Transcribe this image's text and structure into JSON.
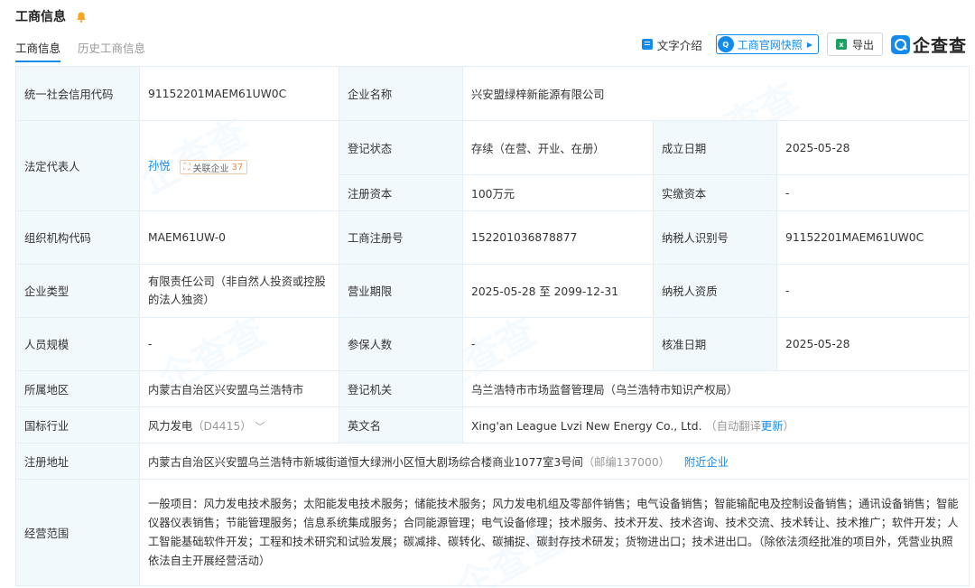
{
  "header": {
    "title": "工商信息"
  },
  "tabs": [
    {
      "label": "工商信息",
      "active": true
    },
    {
      "label": "历史工商信息",
      "active": false
    }
  ],
  "toolbar": {
    "text_intro": "文字介绍",
    "snapshot_badge": "Q",
    "snapshot": "工商官网快照",
    "export": "导出",
    "logo": "企查查"
  },
  "watermark": "企查查",
  "table": {
    "credit_code_label": "统一社会信用代码",
    "credit_code": "91152201MAEM61UW0C",
    "company_name_label": "企业名称",
    "company_name": "兴安盟绿梓新能源有限公司",
    "legal_rep_label": "法定代表人",
    "legal_rep": "孙悦",
    "related_label": "关联企业",
    "related_count": "37",
    "reg_status_label": "登记状态",
    "reg_status": "存续（在营、开业、在册）",
    "established_label": "成立日期",
    "established": "2025-05-28",
    "reg_capital_label": "注册资本",
    "reg_capital": "100万元",
    "paid_capital_label": "实缴资本",
    "paid_capital": "-",
    "org_code_label": "组织机构代码",
    "org_code": "MAEM61UW-0",
    "reg_no_label": "工商注册号",
    "reg_no": "152201036878877",
    "taxpayer_id_label": "纳税人识别号",
    "taxpayer_id": "91152201MAEM61UW0C",
    "company_type_label": "企业类型",
    "company_type": "有限责任公司（非自然人投资或控股的法人独资）",
    "biz_term_label": "营业期限",
    "biz_term": "2025-05-28 至 2099-12-31",
    "taxpayer_qual_label": "纳税人资质",
    "taxpayer_qual": "-",
    "staff_size_label": "人员规模",
    "staff_size": "-",
    "insured_label": "参保人数",
    "insured": "-",
    "approval_date_label": "核准日期",
    "approval_date": "2025-05-28",
    "region_label": "所属地区",
    "region": "内蒙古自治区兴安盟乌兰浩特市",
    "reg_authority_label": "登记机关",
    "reg_authority": "乌兰浩特市市场监督管理局（乌兰浩特市知识产权局）",
    "industry_label": "国标行业",
    "industry": "风力发电",
    "industry_code": "（D4415）",
    "english_name_label": "英文名",
    "english_name": "Xing'an League Lvzi New Energy Co., Ltd.",
    "auto_translate": "（自动翻译",
    "update_link": "更新",
    "auto_translate_close": "）",
    "address_label": "注册地址",
    "address": "内蒙古自治区兴安盟乌兰浩特市新城街道恒大绿洲小区恒大剧场综合楼商业1077室3号间",
    "postcode": "（邮编137000）",
    "nearby_link": "附近企业",
    "scope_label": "经营范围",
    "scope": "一般项目：风力发电技术服务；太阳能发电技术服务；储能技术服务；风力发电机组及零部件销售；电气设备销售；智能输配电及控制设备销售；通讯设备销售；智能仪器仪表销售；节能管理服务；信息系统集成服务；合同能源管理；电气设备修理；技术服务、技术开发、技术咨询、技术交流、技术转让、技术推广；软件开发；人工智能基础软件开发；工程和技术研究和试验发展；碳减排、碳转化、碳捕捉、碳封存技术研发；货物进出口；技术进出口。（除依法须经批准的项目外，凭营业执照依法自主开展经营活动）"
  }
}
